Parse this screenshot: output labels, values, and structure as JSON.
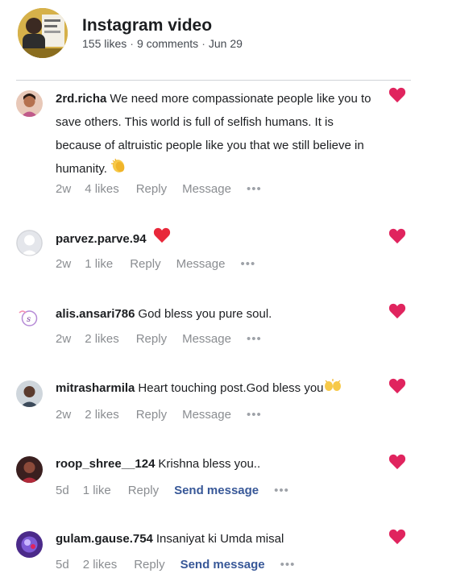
{
  "post": {
    "title": "Instagram video",
    "likes": "155 likes",
    "comments": "9 comments",
    "date": "Jun 29",
    "separator": "·"
  },
  "comments": [
    {
      "username": "2rd.richa",
      "text": "We need more compassionate people like you to save others. This world is full of selfish humans. It is because of altruistic people like you that we still believe in humanity.",
      "emoji": "clapping-hands",
      "age": "2w",
      "likes": "4 likes",
      "reply": "Reply",
      "message": "Message",
      "more": "•••",
      "liked": true
    },
    {
      "username": "parvez.parve.94",
      "text": "",
      "emoji": "red-heart",
      "age": "2w",
      "likes": "1 like",
      "reply": "Reply",
      "message": "Message",
      "more": "•••",
      "liked": true
    },
    {
      "username": "alis.ansari786",
      "text": "God bless you pure soul.",
      "age": "2w",
      "likes": "2 likes",
      "reply": "Reply",
      "message": "Message",
      "more": "•••",
      "liked": true
    },
    {
      "username": "mitrasharmila",
      "text": "Heart touching post.God bless you",
      "emoji": "raising-hands",
      "age": "2w",
      "likes": "2 likes",
      "reply": "Reply",
      "message": "Message",
      "more": "•••",
      "liked": true
    },
    {
      "username": "roop_shree__124",
      "text": "Krishna bless you..",
      "age": "5d",
      "likes": "1 like",
      "reply": "Reply",
      "message": "Send message",
      "more": "•••",
      "liked": true
    },
    {
      "username": "gulam.gause.754",
      "text": "Insaniyat ki Umda misal",
      "age": "5d",
      "likes": "2 likes",
      "reply": "Reply",
      "message": "Send message",
      "more": "•••",
      "liked": true
    }
  ],
  "colors": {
    "heart": "#e0245e",
    "send_message": "#385898",
    "meta_text": "#8a8d91"
  }
}
